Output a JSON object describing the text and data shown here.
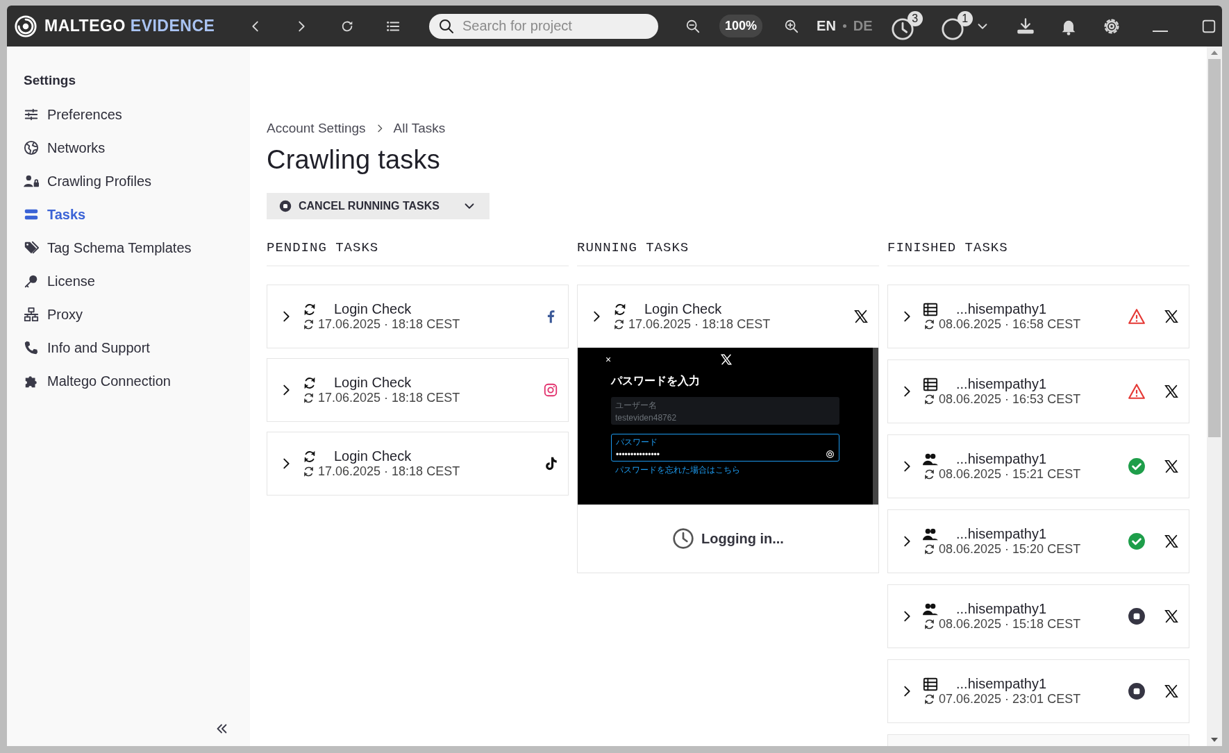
{
  "window": {
    "brand": "MALTEGO",
    "product": "EVIDENCE"
  },
  "toolbar": {
    "search": {
      "placeholder": "Search for project"
    },
    "zoom": "100%",
    "languages": [
      {
        "label": "EN",
        "selected": true
      },
      {
        "label": "DE",
        "selected": false
      }
    ],
    "task_badge": "3",
    "process_badge": "1"
  },
  "sidebar": {
    "heading": "Settings",
    "items": [
      {
        "label": "Preferences",
        "selected": false
      },
      {
        "label": "Networks",
        "selected": false
      },
      {
        "label": "Crawling Profiles",
        "selected": false
      },
      {
        "label": "Tasks",
        "selected": true
      },
      {
        "label": "Tag Schema Templates",
        "selected": false
      },
      {
        "label": "License",
        "selected": false
      },
      {
        "label": "Proxy",
        "selected": false
      },
      {
        "label": "Info and Support",
        "selected": false
      },
      {
        "label": "Maltego Connection",
        "selected": false
      }
    ]
  },
  "breadcrumb": [
    "Account Settings",
    "All Tasks"
  ],
  "title": "Crawling tasks",
  "cancel_button": "CANCEL RUNNING TASKS",
  "columns": [
    {
      "heading": "PENDING TASKS",
      "tasks": [
        {
          "kind": "task",
          "title": "Login Check",
          "time": "17.06.2025 · 18:18 CEST"
        },
        {
          "kind": "task",
          "title": "Login Check",
          "time": "17.06.2025 · 18:18 CEST"
        },
        {
          "kind": "task",
          "title": "Login Check",
          "time": "17.06.2025 · 18:18 CEST"
        }
      ]
    },
    {
      "heading": "RUNNING TASKS",
      "tasks": [
        {
          "kind": "task",
          "title": "Login Check",
          "time": "17.06.2025 · 18:18 CEST",
          "preview": {
            "close": "×",
            "heading": "パスワードを入力",
            "username_label": "ユーザー名",
            "username": "testeviden48762",
            "password_label": "パスワード",
            "password": "•••••••••••••••",
            "forgot_link": "パスワードを忘れた場合はこちら"
          },
          "progress": "Logging in..."
        }
      ]
    },
    {
      "heading": "FINISHED TASKS",
      "tasks": [
        {
          "kind": "task",
          "title": "...hisempathy1",
          "time": "08.06.2025 · 16:58 CEST",
          "failed": true,
          "succeeded": false
        },
        {
          "kind": "task",
          "title": "...hisempathy1",
          "time": "08.06.2025 · 16:53 CEST",
          "failed": true,
          "succeeded": false
        },
        {
          "kind": "task",
          "title": "...hisempathy1",
          "time": "08.06.2025 · 15:21 CEST",
          "failed": false,
          "succeeded": true
        },
        {
          "kind": "task",
          "title": "...hisempathy1",
          "time": "08.06.2025 · 15:20 CEST",
          "failed": false,
          "succeeded": true
        },
        {
          "kind": "task",
          "title": "...hisempathy1",
          "time": "08.06.2025 · 15:18 CEST",
          "failed": false,
          "succeeded": false
        },
        {
          "kind": "task",
          "title": "...hisempathy1",
          "time": "07.06.2025 · 23:01 CEST",
          "failed": false,
          "succeeded": false
        },
        {
          "kind": "loading"
        }
      ]
    }
  ]
}
